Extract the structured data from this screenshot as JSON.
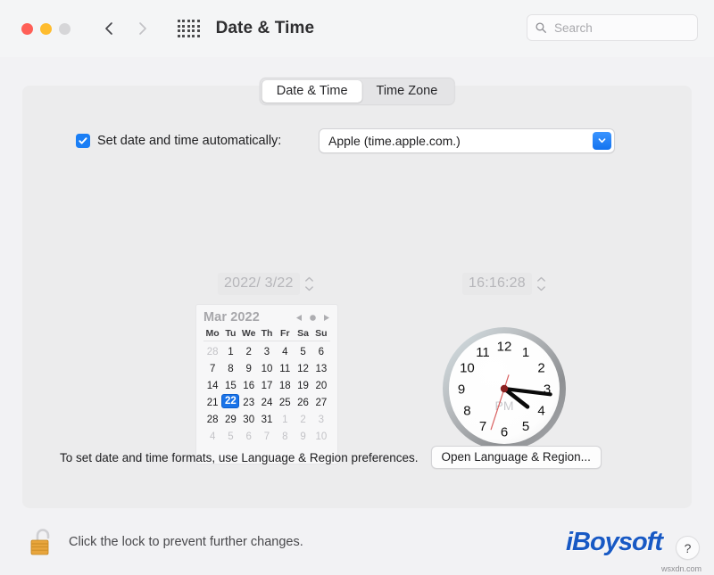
{
  "window": {
    "title": "Date & Time",
    "traffic_lights": [
      "close",
      "minimize",
      "maximize"
    ],
    "back_icon": "chevron-left-icon",
    "forward_icon": "chevron-right-icon",
    "grid_icon": "grid-dots-icon"
  },
  "search": {
    "placeholder": "Search",
    "value": "",
    "icon": "search-icon"
  },
  "tabs": [
    {
      "label": "Date & Time",
      "active": true
    },
    {
      "label": "Time Zone",
      "active": false
    }
  ],
  "auto_set": {
    "checked": true,
    "label": "Set date and time automatically:",
    "server": "Apple (time.apple.com.)",
    "dropdown_icon": "chevron-down-icon"
  },
  "date_field": {
    "value": "2022/ 3/22",
    "enabled": false,
    "stepper_icon": "stepper-up-down-icon"
  },
  "time_field": {
    "value": "16:16:28",
    "enabled": false,
    "stepper_icon": "stepper-up-down-icon"
  },
  "calendar": {
    "month_label": "Mar 2022",
    "prev_icon": "triangle-left-icon",
    "today_icon": "circle-dot-icon",
    "next_icon": "triangle-right-icon",
    "weekdays": [
      "Mo",
      "Tu",
      "We",
      "Th",
      "Fr",
      "Sa",
      "Su"
    ],
    "selected_day": 22,
    "weeks": [
      [
        {
          "d": "28",
          "dim": true
        },
        {
          "d": "1"
        },
        {
          "d": "2"
        },
        {
          "d": "3"
        },
        {
          "d": "4"
        },
        {
          "d": "5"
        },
        {
          "d": "6"
        }
      ],
      [
        {
          "d": "7"
        },
        {
          "d": "8"
        },
        {
          "d": "9"
        },
        {
          "d": "10"
        },
        {
          "d": "11"
        },
        {
          "d": "12"
        },
        {
          "d": "13"
        }
      ],
      [
        {
          "d": "14"
        },
        {
          "d": "15"
        },
        {
          "d": "16"
        },
        {
          "d": "17"
        },
        {
          "d": "18"
        },
        {
          "d": "19"
        },
        {
          "d": "20"
        }
      ],
      [
        {
          "d": "21"
        },
        {
          "d": "22",
          "sel": true
        },
        {
          "d": "23"
        },
        {
          "d": "24"
        },
        {
          "d": "25"
        },
        {
          "d": "26"
        },
        {
          "d": "27"
        }
      ],
      [
        {
          "d": "28"
        },
        {
          "d": "29"
        },
        {
          "d": "30"
        },
        {
          "d": "31"
        },
        {
          "d": "1",
          "dim": true
        },
        {
          "d": "2",
          "dim": true
        },
        {
          "d": "3",
          "dim": true
        }
      ],
      [
        {
          "d": "4",
          "dim": true
        },
        {
          "d": "5",
          "dim": true
        },
        {
          "d": "6",
          "dim": true
        },
        {
          "d": "7",
          "dim": true
        },
        {
          "d": "8",
          "dim": true
        },
        {
          "d": "9",
          "dim": true
        },
        {
          "d": "10",
          "dim": true
        }
      ]
    ]
  },
  "clock": {
    "meridiem": "PM",
    "hours": [
      "12",
      "1",
      "2",
      "3",
      "4",
      "5",
      "6",
      "7",
      "8",
      "9",
      "10",
      "11"
    ],
    "hour_angle": 128,
    "minute_angle": 97,
    "second_angle": 198,
    "second_hand_color": "#d95f5f",
    "hand_color": "#0a0a0a",
    "face_color": "#ffffff",
    "bezel_color": "#9a9a9d"
  },
  "format_row": {
    "text": "To set date and time formats, use Language & Region preferences.",
    "button_label": "Open Language & Region..."
  },
  "bottom": {
    "lock_icon": "unlocked-padlock-icon",
    "lock_text": "Click the lock to prevent further changes.",
    "help_label": "?",
    "logo_text": "iBoysoft",
    "watermark": "wsxdn.com"
  }
}
